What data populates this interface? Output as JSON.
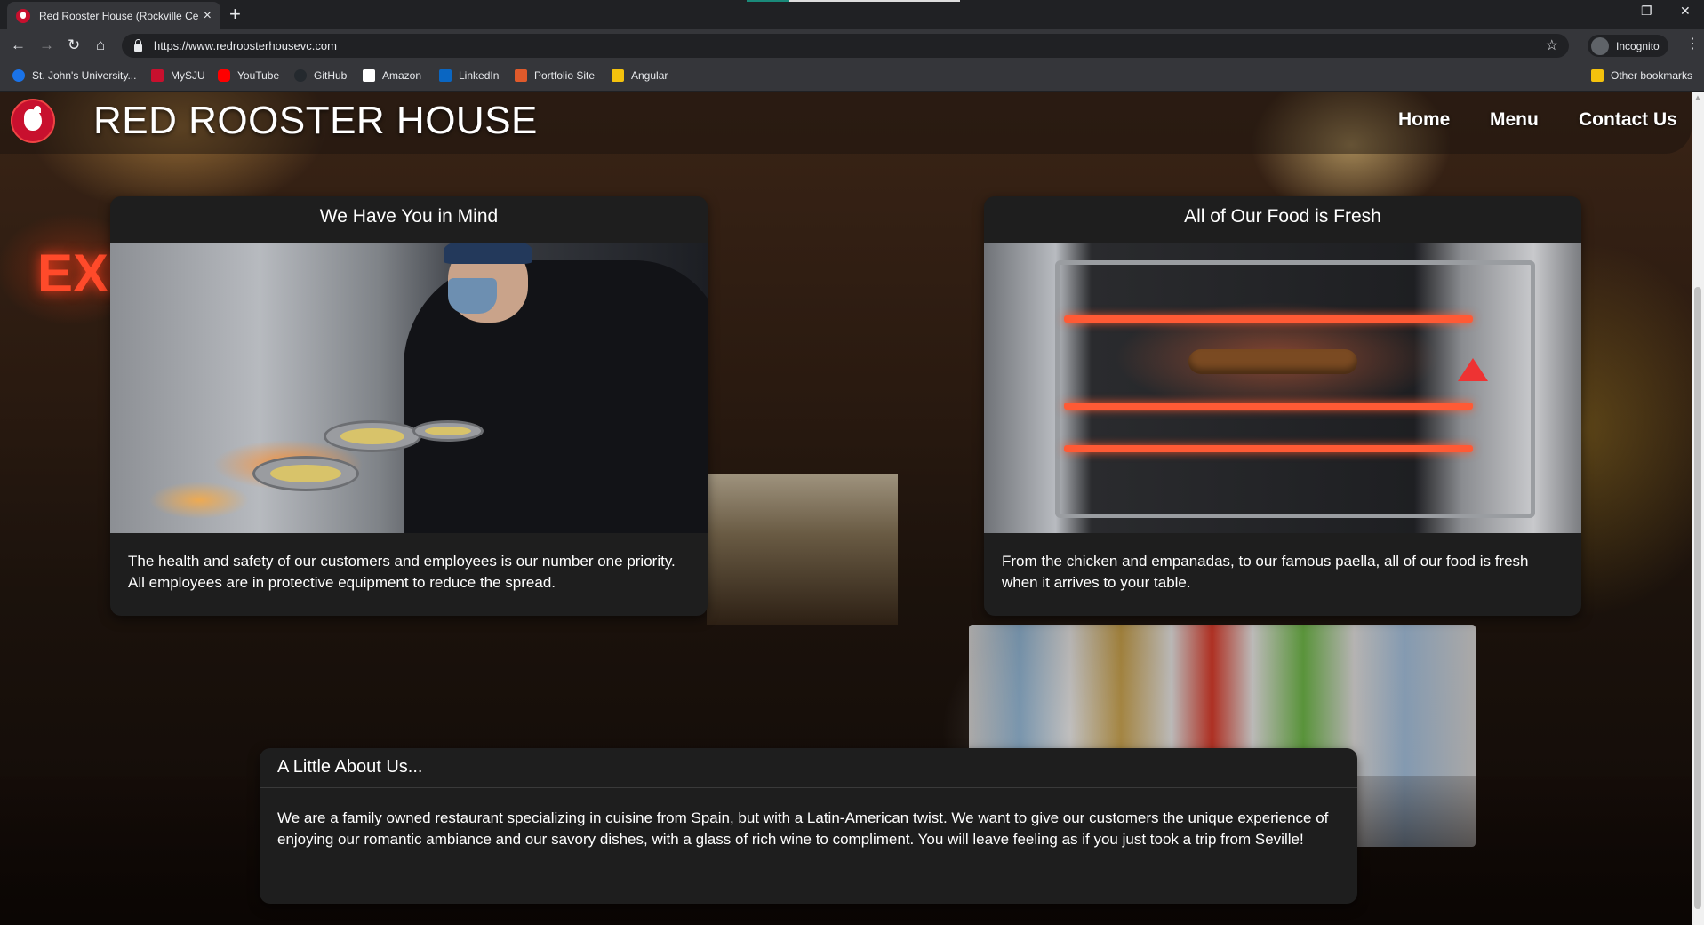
{
  "browser": {
    "tab_title": "Red Rooster House (Rockville Ce",
    "url": "https://www.redroosterhousevc.com",
    "profile_label": "Incognito",
    "bookmarks": [
      {
        "label": "St. John's University...",
        "icon_color": "#1a73e8"
      },
      {
        "label": "MySJU",
        "icon_color": "#c8102e"
      },
      {
        "label": "YouTube",
        "icon_color": "#ff0000"
      },
      {
        "label": "GitHub",
        "icon_color": "#24292e"
      },
      {
        "label": "Amazon",
        "icon_color": "#ffffff"
      },
      {
        "label": "LinkedIn",
        "icon_color": "#0a66c2"
      },
      {
        "label": "Portfolio Site",
        "icon_color": "#e05a2b"
      },
      {
        "label": "Angular",
        "icon_color": "#f4c20d"
      }
    ],
    "other_bookmarks": "Other bookmarks"
  },
  "site": {
    "brand": "RED ROOSTER HOUSE",
    "nav": [
      "Home",
      "Menu",
      "Contact Us"
    ],
    "accent_color": "#c8102e"
  },
  "cards": [
    {
      "title": "We Have You in Mind",
      "text": "The health and safety of our customers and employees is our number one priority. All employees are in protective equipment to reduce the spread."
    },
    {
      "title": "All of Our Food is Fresh",
      "text": "From the chicken and empanadas, to our famous paella, all of our food is fresh when it arrives to your table."
    }
  ],
  "about": {
    "title": "A Little About Us...",
    "text": "We are a family owned restaurant specializing in cuisine from Spain, but with a Latin-American twist. We want to give our customers the unique experience of enjoying our romantic ambiance and our savory dishes, with a glass of rich wine to compliment. You will leave feeling as if you just took a trip from Seville!"
  },
  "decor": {
    "exit_sign": "EXIT"
  }
}
